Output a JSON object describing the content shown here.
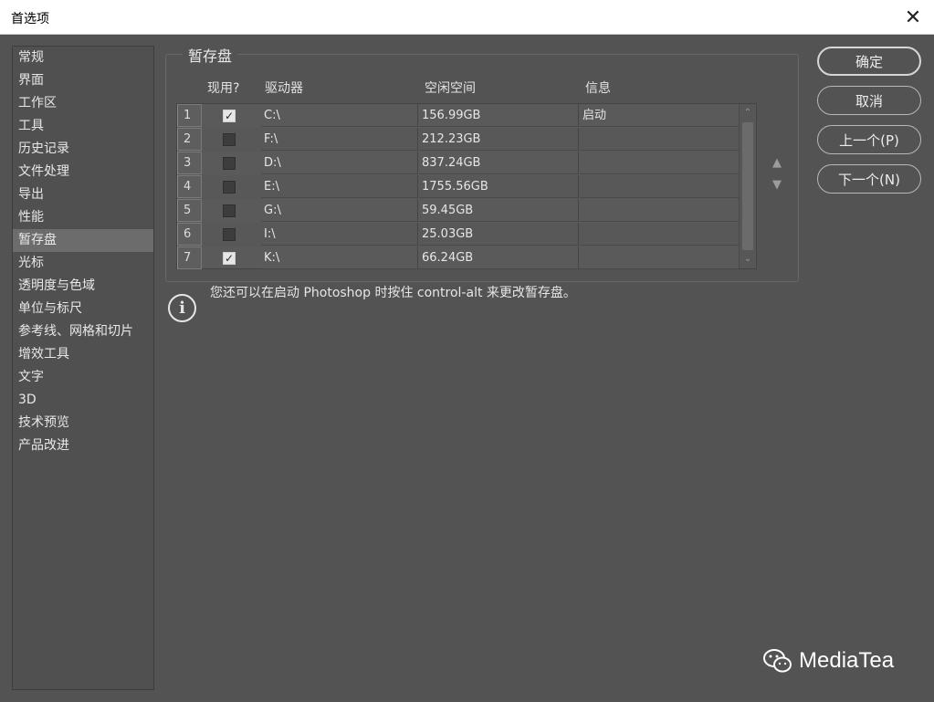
{
  "window": {
    "title": "首选项",
    "close_symbol": "✕"
  },
  "sidebar": {
    "items": [
      {
        "label": "常规"
      },
      {
        "label": "界面"
      },
      {
        "label": "工作区"
      },
      {
        "label": "工具"
      },
      {
        "label": "历史记录"
      },
      {
        "label": "文件处理"
      },
      {
        "label": "导出"
      },
      {
        "label": "性能"
      },
      {
        "label": "暂存盘"
      },
      {
        "label": "光标"
      },
      {
        "label": "透明度与色域"
      },
      {
        "label": "单位与标尺"
      },
      {
        "label": "参考线、网格和切片"
      },
      {
        "label": "增效工具"
      },
      {
        "label": "文字"
      },
      {
        "label": "3D"
      },
      {
        "label": "技术预览"
      },
      {
        "label": "产品改进"
      }
    ],
    "active_index": 8
  },
  "scratch": {
    "group_title": "暂存盘",
    "columns": {
      "enabled": "现用?",
      "drive": "驱动器",
      "free_space": "空闲空间",
      "info": "信息"
    },
    "rows": [
      {
        "num": "1",
        "checked": true,
        "drive": "C:\\",
        "free": "156.99GB",
        "info": "启动"
      },
      {
        "num": "2",
        "checked": false,
        "drive": "F:\\",
        "free": "212.23GB",
        "info": ""
      },
      {
        "num": "3",
        "checked": false,
        "drive": "D:\\",
        "free": "837.24GB",
        "info": ""
      },
      {
        "num": "4",
        "checked": false,
        "drive": "E:\\",
        "free": "1755.56GB",
        "info": ""
      },
      {
        "num": "5",
        "checked": false,
        "drive": "G:\\",
        "free": "59.45GB",
        "info": ""
      },
      {
        "num": "6",
        "checked": false,
        "drive": "I:\\",
        "free": "25.03GB",
        "info": ""
      },
      {
        "num": "7",
        "checked": true,
        "drive": "K:\\",
        "free": "66.24GB",
        "info": ""
      }
    ],
    "move_up_symbol": "▲",
    "move_down_symbol": "▼",
    "hint": "您还可以在启动 Photoshop 时按住 control-alt 来更改暂存盘。",
    "info_symbol": "i"
  },
  "buttons": {
    "ok": "确定",
    "cancel": "取消",
    "prev": "上一个(P)",
    "next": "下一个(N)"
  },
  "watermark": {
    "text": "MediaTea"
  }
}
